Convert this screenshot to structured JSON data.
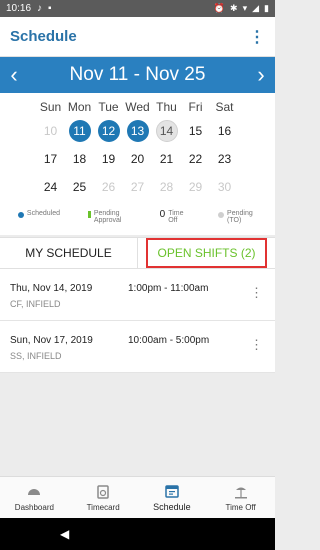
{
  "status": {
    "time": "10:16"
  },
  "appbar": {
    "title": "Schedule",
    "menu_icon": "more-vert-icon"
  },
  "week": {
    "range": "Nov 11 - Nov 25",
    "prev_icon": "chevron-left-icon",
    "next_icon": "chevron-right-icon"
  },
  "calendar": {
    "days_of_week": [
      "Sun",
      "Mon",
      "Tue",
      "Wed",
      "Thu",
      "Fri",
      "Sat"
    ],
    "weeks": [
      [
        {
          "n": "10",
          "s": "dim"
        },
        {
          "n": "11",
          "s": "sched"
        },
        {
          "n": "12",
          "s": "sched"
        },
        {
          "n": "13",
          "s": "sched"
        },
        {
          "n": "14",
          "s": "today"
        },
        {
          "n": "15",
          "s": ""
        },
        {
          "n": "16",
          "s": ""
        }
      ],
      [
        {
          "n": "17",
          "s": ""
        },
        {
          "n": "18",
          "s": ""
        },
        {
          "n": "19",
          "s": ""
        },
        {
          "n": "20",
          "s": ""
        },
        {
          "n": "21",
          "s": ""
        },
        {
          "n": "22",
          "s": ""
        },
        {
          "n": "23",
          "s": ""
        }
      ],
      [
        {
          "n": "24",
          "s": ""
        },
        {
          "n": "25",
          "s": ""
        },
        {
          "n": "26",
          "s": "dim"
        },
        {
          "n": "27",
          "s": "dim"
        },
        {
          "n": "28",
          "s": "dim"
        },
        {
          "n": "29",
          "s": "dim"
        },
        {
          "n": "30",
          "s": "dim"
        }
      ]
    ]
  },
  "legend": {
    "scheduled": "Scheduled",
    "pending": "Pending Approval",
    "time_off_value": "0",
    "time_off": "Time Off",
    "pending_to": "Pending (TO)",
    "colors": {
      "scheduled": "#1f78b4",
      "pending": "#6ac22c",
      "pending_to": "#cfcfcf"
    }
  },
  "tabs": {
    "my_schedule": "MY SCHEDULE",
    "open_shifts": "OPEN SHIFTS (2)"
  },
  "shifts": [
    {
      "date": "Thu, Nov 14, 2019",
      "time": "1:00pm - 11:00am",
      "location": "CF, INFIELD"
    },
    {
      "date": "Sun, Nov 17, 2019",
      "time": "10:00am - 5:00pm",
      "location": "SS, INFIELD"
    }
  ],
  "bottom_nav": {
    "dashboard": "Dashboard",
    "timecard": "Timecard",
    "schedule": "Schedule",
    "time_off": "Time Off"
  }
}
